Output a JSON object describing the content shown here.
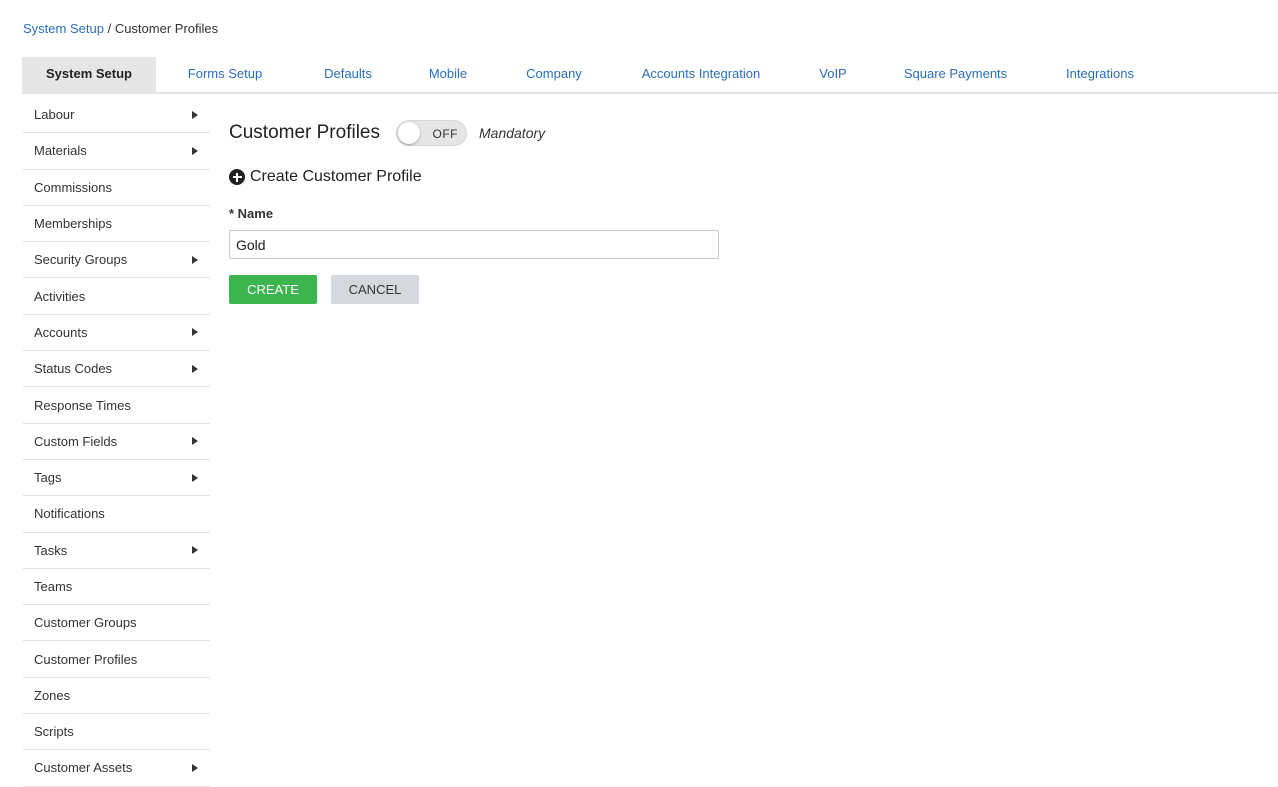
{
  "breadcrumb": {
    "root": "System Setup",
    "separator": "/",
    "current": "Customer Profiles"
  },
  "tabs": [
    {
      "label": "System Setup",
      "active": true
    },
    {
      "label": "Forms Setup",
      "active": false
    },
    {
      "label": "Defaults",
      "active": false
    },
    {
      "label": "Mobile",
      "active": false
    },
    {
      "label": "Company",
      "active": false
    },
    {
      "label": "Accounts Integration",
      "active": false
    },
    {
      "label": "VoIP",
      "active": false
    },
    {
      "label": "Square Payments",
      "active": false
    },
    {
      "label": "Integrations",
      "active": false
    }
  ],
  "sidebar": {
    "items": [
      {
        "label": "Labour",
        "has_submenu": true
      },
      {
        "label": "Materials",
        "has_submenu": true
      },
      {
        "label": "Commissions",
        "has_submenu": false
      },
      {
        "label": "Memberships",
        "has_submenu": false
      },
      {
        "label": "Security Groups",
        "has_submenu": true
      },
      {
        "label": "Activities",
        "has_submenu": false
      },
      {
        "label": "Accounts",
        "has_submenu": true
      },
      {
        "label": "Status Codes",
        "has_submenu": true
      },
      {
        "label": "Response Times",
        "has_submenu": false
      },
      {
        "label": "Custom Fields",
        "has_submenu": true
      },
      {
        "label": "Tags",
        "has_submenu": true
      },
      {
        "label": "Notifications",
        "has_submenu": false
      },
      {
        "label": "Tasks",
        "has_submenu": true
      },
      {
        "label": "Teams",
        "has_submenu": false
      },
      {
        "label": "Customer Groups",
        "has_submenu": false
      },
      {
        "label": "Customer Profiles",
        "has_submenu": false
      },
      {
        "label": "Zones",
        "has_submenu": false
      },
      {
        "label": "Scripts",
        "has_submenu": false
      },
      {
        "label": "Customer Assets",
        "has_submenu": true
      }
    ]
  },
  "main": {
    "title": "Customer Profiles",
    "toggle": {
      "state_text": "OFF",
      "on": false
    },
    "mandatory_label": "Mandatory",
    "create_heading": "Create Customer Profile",
    "create_icon": "plus-circle-icon",
    "name_label": "* Name",
    "name_value": "Gold",
    "create_button": "CREATE",
    "cancel_button": "CANCEL"
  },
  "colors": {
    "link": "#2a6ebb",
    "create_button": "#3cb54e",
    "cancel_button": "#d5d8dc",
    "active_tab": "#e6e6e6"
  }
}
